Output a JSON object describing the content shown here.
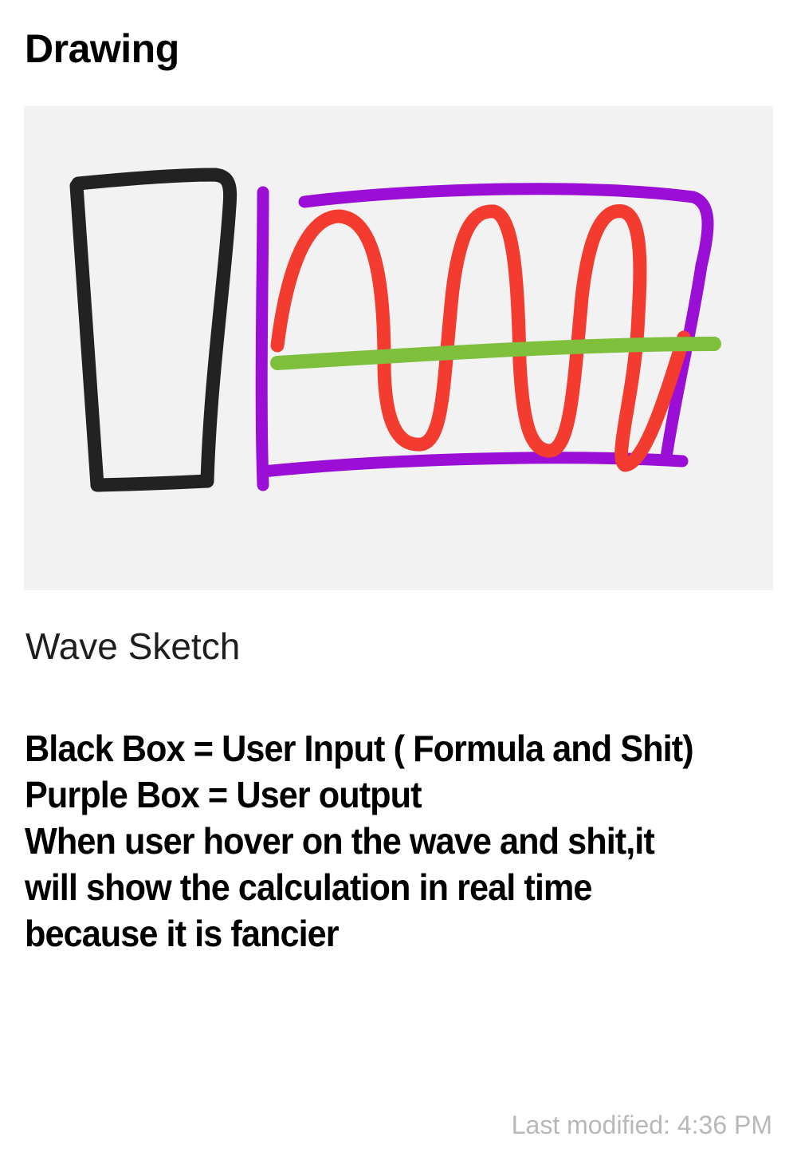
{
  "header": {
    "title": "Drawing"
  },
  "drawing": {
    "colors": {
      "background": "#f2f2f2",
      "black_box": "#222222",
      "purple_box": "#9a0ed6",
      "wave": "#f43b2f",
      "axis": "#7ebf3c"
    },
    "title": "Wave Sketch"
  },
  "note": {
    "lines": [
      "Black Box = User Input ( Formula and Shit)",
      "Purple Box = User output",
      "When user hover on the wave and shit,it",
      "will show the calculation in real time",
      "because it is fancier"
    ]
  },
  "footer": {
    "last_modified": "Last modified: 4:36 PM"
  }
}
